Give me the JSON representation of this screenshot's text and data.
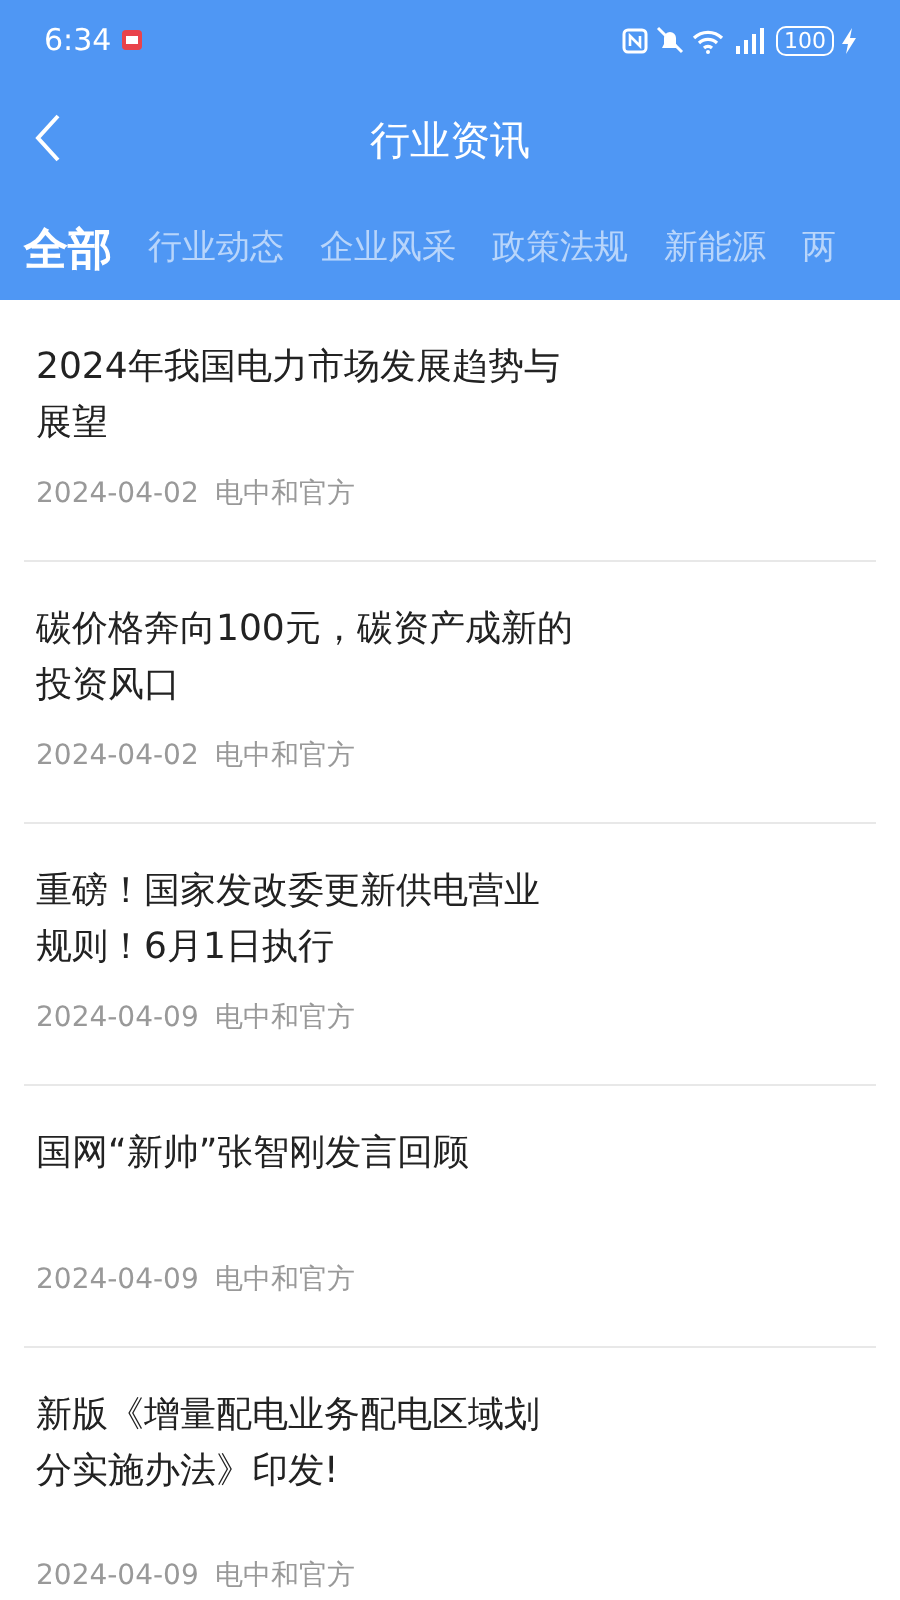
{
  "status_bar": {
    "time": "6:34",
    "battery": "100"
  },
  "header": {
    "title": "行业资讯"
  },
  "tabs": [
    {
      "label": "全部",
      "selected": true
    },
    {
      "label": "行业动态",
      "selected": false
    },
    {
      "label": "企业风采",
      "selected": false
    },
    {
      "label": "政策法规",
      "selected": false
    },
    {
      "label": "新能源",
      "selected": false
    },
    {
      "label": "两",
      "selected": false
    }
  ],
  "articles": [
    {
      "title_lines": [
        "2024年我国电力市场发展趋势与",
        "展望"
      ],
      "date": "2024-04-02",
      "source": "电中和官方"
    },
    {
      "title_lines": [
        "碳价格奔向100元，碳资产成新的",
        "投资风口"
      ],
      "date": "2024-04-02",
      "source": "电中和官方"
    },
    {
      "title_lines": [
        "重磅！国家发改委更新供电营业",
        "规则！6月1日执行"
      ],
      "date": "2024-04-09",
      "source": "电中和官方"
    },
    {
      "title_lines": [
        "国网“新帅”张智刚发言回顾"
      ],
      "date": "2024-04-09",
      "source": "电中和官方"
    },
    {
      "title_lines": [
        "新版《增量配电业务配电区域划",
        "分实施办法》印发!"
      ],
      "date": "2024-04-09",
      "source": "电中和官方"
    }
  ]
}
